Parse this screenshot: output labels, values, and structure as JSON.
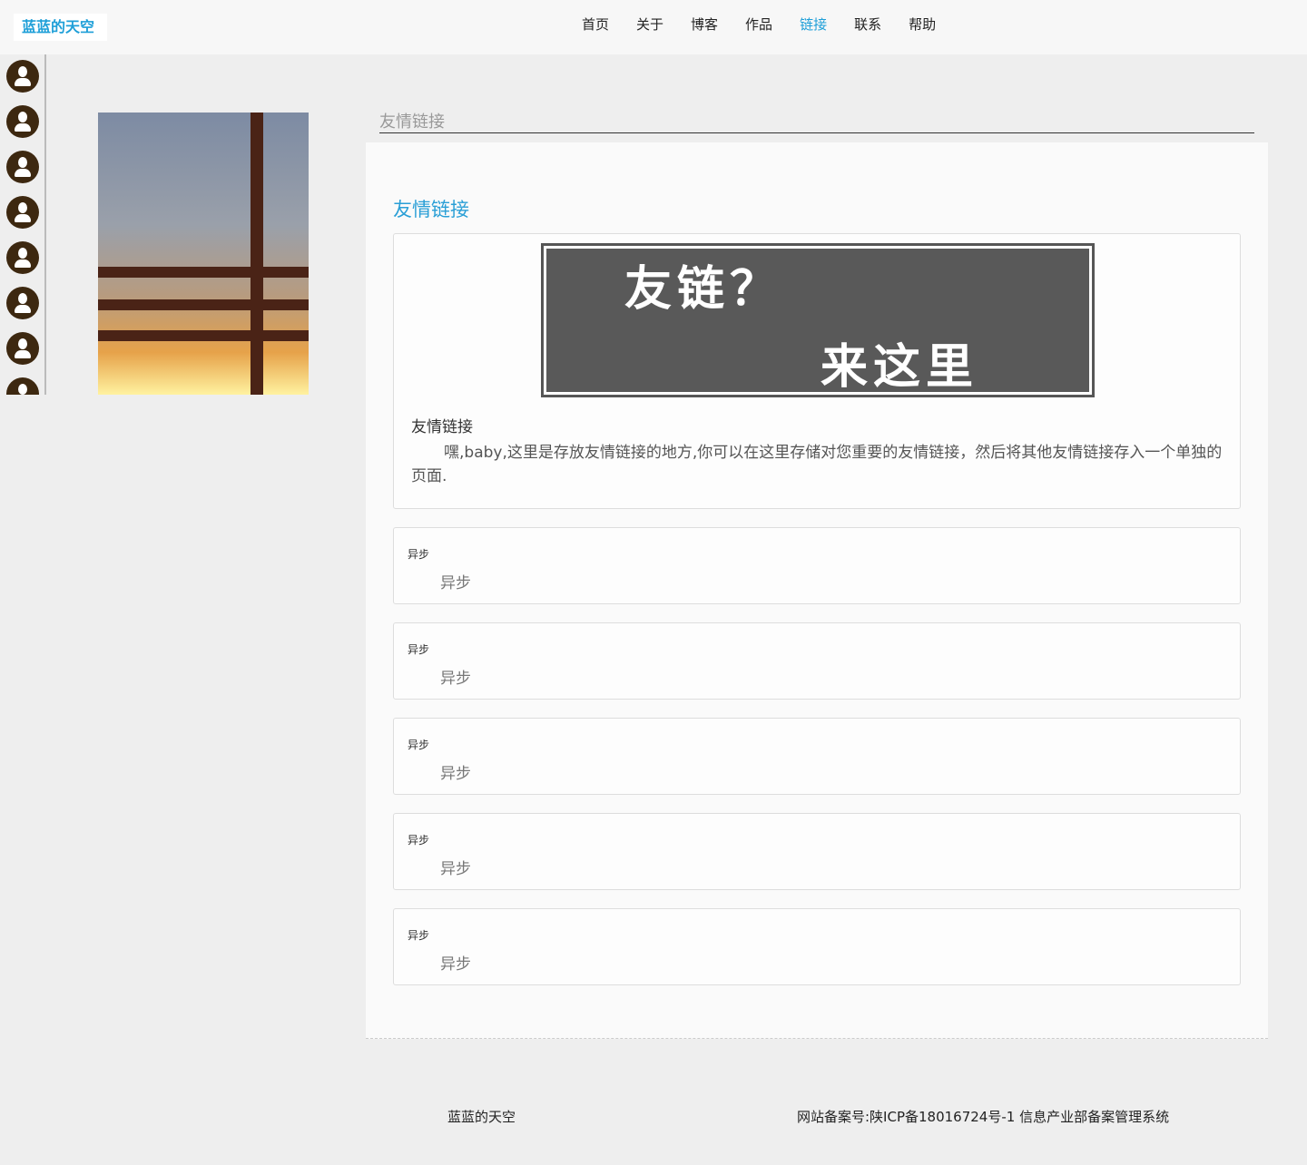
{
  "header": {
    "logo": "蓝蓝的天空",
    "nav": [
      "首页",
      "关于",
      "博客",
      "作品",
      "链接",
      "联系",
      "帮助"
    ],
    "active": "链接"
  },
  "section_title": "友情链接",
  "panel": {
    "heading": "友情链接",
    "banner": {
      "line1": "友链？",
      "line2": "来这里"
    },
    "card_title": "友情链接",
    "card_desc": "嘿,baby,这里是存放友情链接的地方,你可以在这里存储对您重要的友情链接，然后将其他友情链接存入一个单独的页面."
  },
  "links": [
    {
      "title": "异步",
      "value": "异步"
    },
    {
      "title": "异步",
      "value": "异步"
    },
    {
      "title": "异步",
      "value": "异步"
    },
    {
      "title": "异步",
      "value": "异步"
    },
    {
      "title": "异步",
      "value": "异步"
    }
  ],
  "footer": {
    "site": "蓝蓝的天空",
    "icp": "网站备案号:陕ICP备18016724号-1 信息产业部备案管理系统"
  },
  "colors": {
    "accent": "#1e9fd8",
    "avatar": "#3d2810"
  }
}
